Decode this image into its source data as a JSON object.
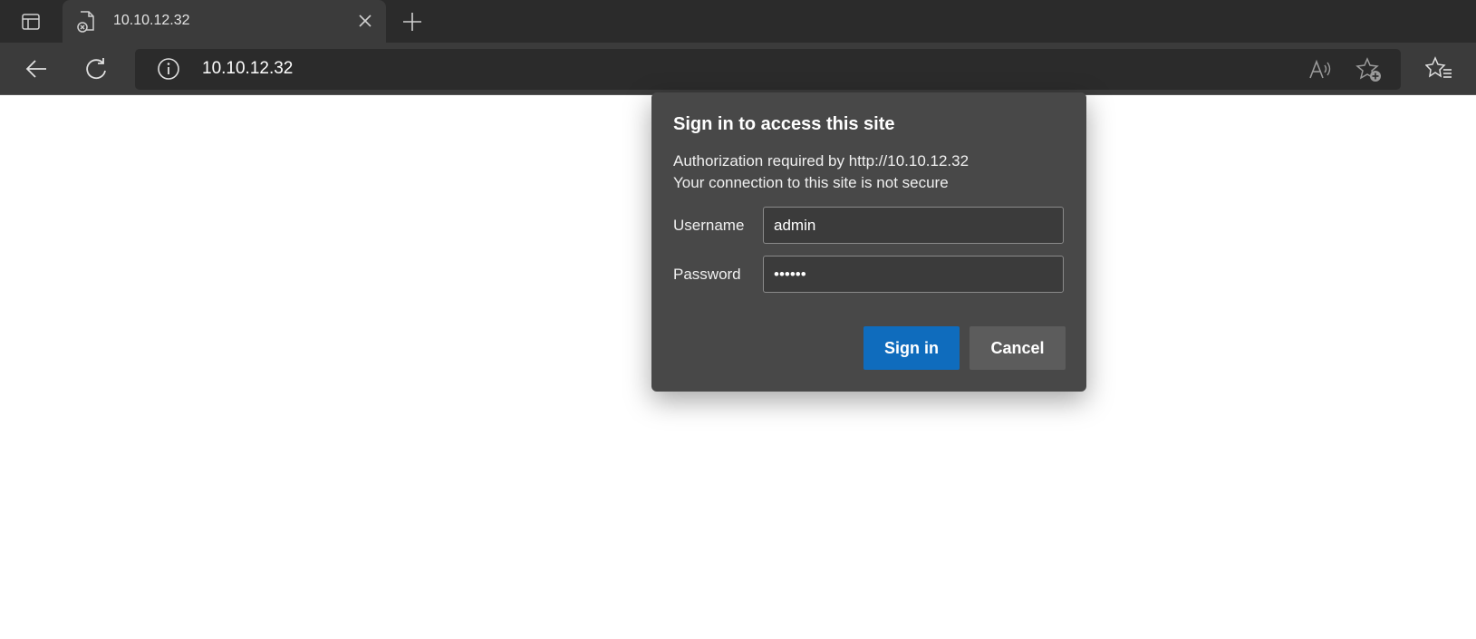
{
  "tab": {
    "title": "10.10.12.32"
  },
  "address_bar": {
    "url": "10.10.12.32"
  },
  "dialog": {
    "title": "Sign in to access this site",
    "line1": "Authorization required by http://10.10.12.32",
    "line2": "Your connection to this site is not secure",
    "username_label": "Username",
    "username_value": "admin",
    "password_label": "Password",
    "password_value": "••••••",
    "signin_label": "Sign in",
    "cancel_label": "Cancel"
  },
  "colors": {
    "primary_button": "#0f6cbd",
    "dialog_bg": "#484848",
    "chrome_dark": "#2b2b2b",
    "chrome_toolbar": "#3b3b3b"
  }
}
